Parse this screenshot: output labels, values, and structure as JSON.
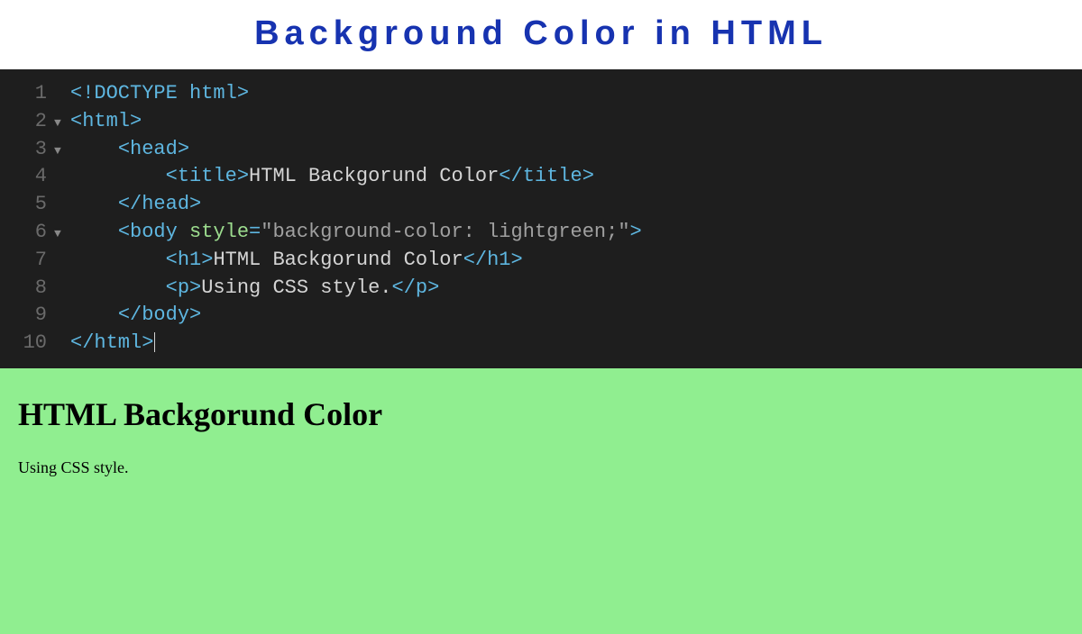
{
  "header": {
    "title": "Background Color in HTML"
  },
  "code": {
    "lines": [
      {
        "num": "1",
        "fold": "",
        "indent": "",
        "tokens": [
          {
            "t": "doctype",
            "v": "<!DOCTYPE html>"
          }
        ]
      },
      {
        "num": "2",
        "fold": "▼",
        "indent": "",
        "tokens": [
          {
            "t": "tag",
            "v": "<html>"
          }
        ]
      },
      {
        "num": "3",
        "fold": "▼",
        "indent": "    ",
        "tokens": [
          {
            "t": "tag",
            "v": "<head>"
          }
        ]
      },
      {
        "num": "4",
        "fold": "",
        "indent": "        ",
        "tokens": [
          {
            "t": "tag",
            "v": "<title>"
          },
          {
            "t": "text",
            "v": "HTML Backgorund Color"
          },
          {
            "t": "tag",
            "v": "</title>"
          }
        ]
      },
      {
        "num": "5",
        "fold": "",
        "indent": "    ",
        "tokens": [
          {
            "t": "tag",
            "v": "</head>"
          }
        ]
      },
      {
        "num": "6",
        "fold": "▼",
        "indent": "    ",
        "tokens": [
          {
            "t": "tag-open",
            "v": "<body "
          },
          {
            "t": "attr",
            "v": "style"
          },
          {
            "t": "eq",
            "v": "="
          },
          {
            "t": "val",
            "v": "\"background-color: lightgreen;\""
          },
          {
            "t": "tag-close",
            "v": ">"
          }
        ]
      },
      {
        "num": "7",
        "fold": "",
        "indent": "        ",
        "tokens": [
          {
            "t": "tag",
            "v": "<h1>"
          },
          {
            "t": "text",
            "v": "HTML Backgorund Color"
          },
          {
            "t": "tag",
            "v": "</h1>"
          }
        ]
      },
      {
        "num": "8",
        "fold": "",
        "indent": "        ",
        "tokens": [
          {
            "t": "tag",
            "v": "<p>"
          },
          {
            "t": "text",
            "v": "Using CSS style."
          },
          {
            "t": "tag",
            "v": "</p>"
          }
        ]
      },
      {
        "num": "9",
        "fold": "",
        "indent": "    ",
        "tokens": [
          {
            "t": "tag",
            "v": "</body>"
          }
        ]
      },
      {
        "num": "10",
        "fold": "",
        "indent": "",
        "tokens": [
          {
            "t": "tag",
            "v": "</html>"
          }
        ],
        "cursor": true
      }
    ]
  },
  "preview": {
    "heading": "HTML Backgorund Color",
    "paragraph": "Using CSS style."
  }
}
